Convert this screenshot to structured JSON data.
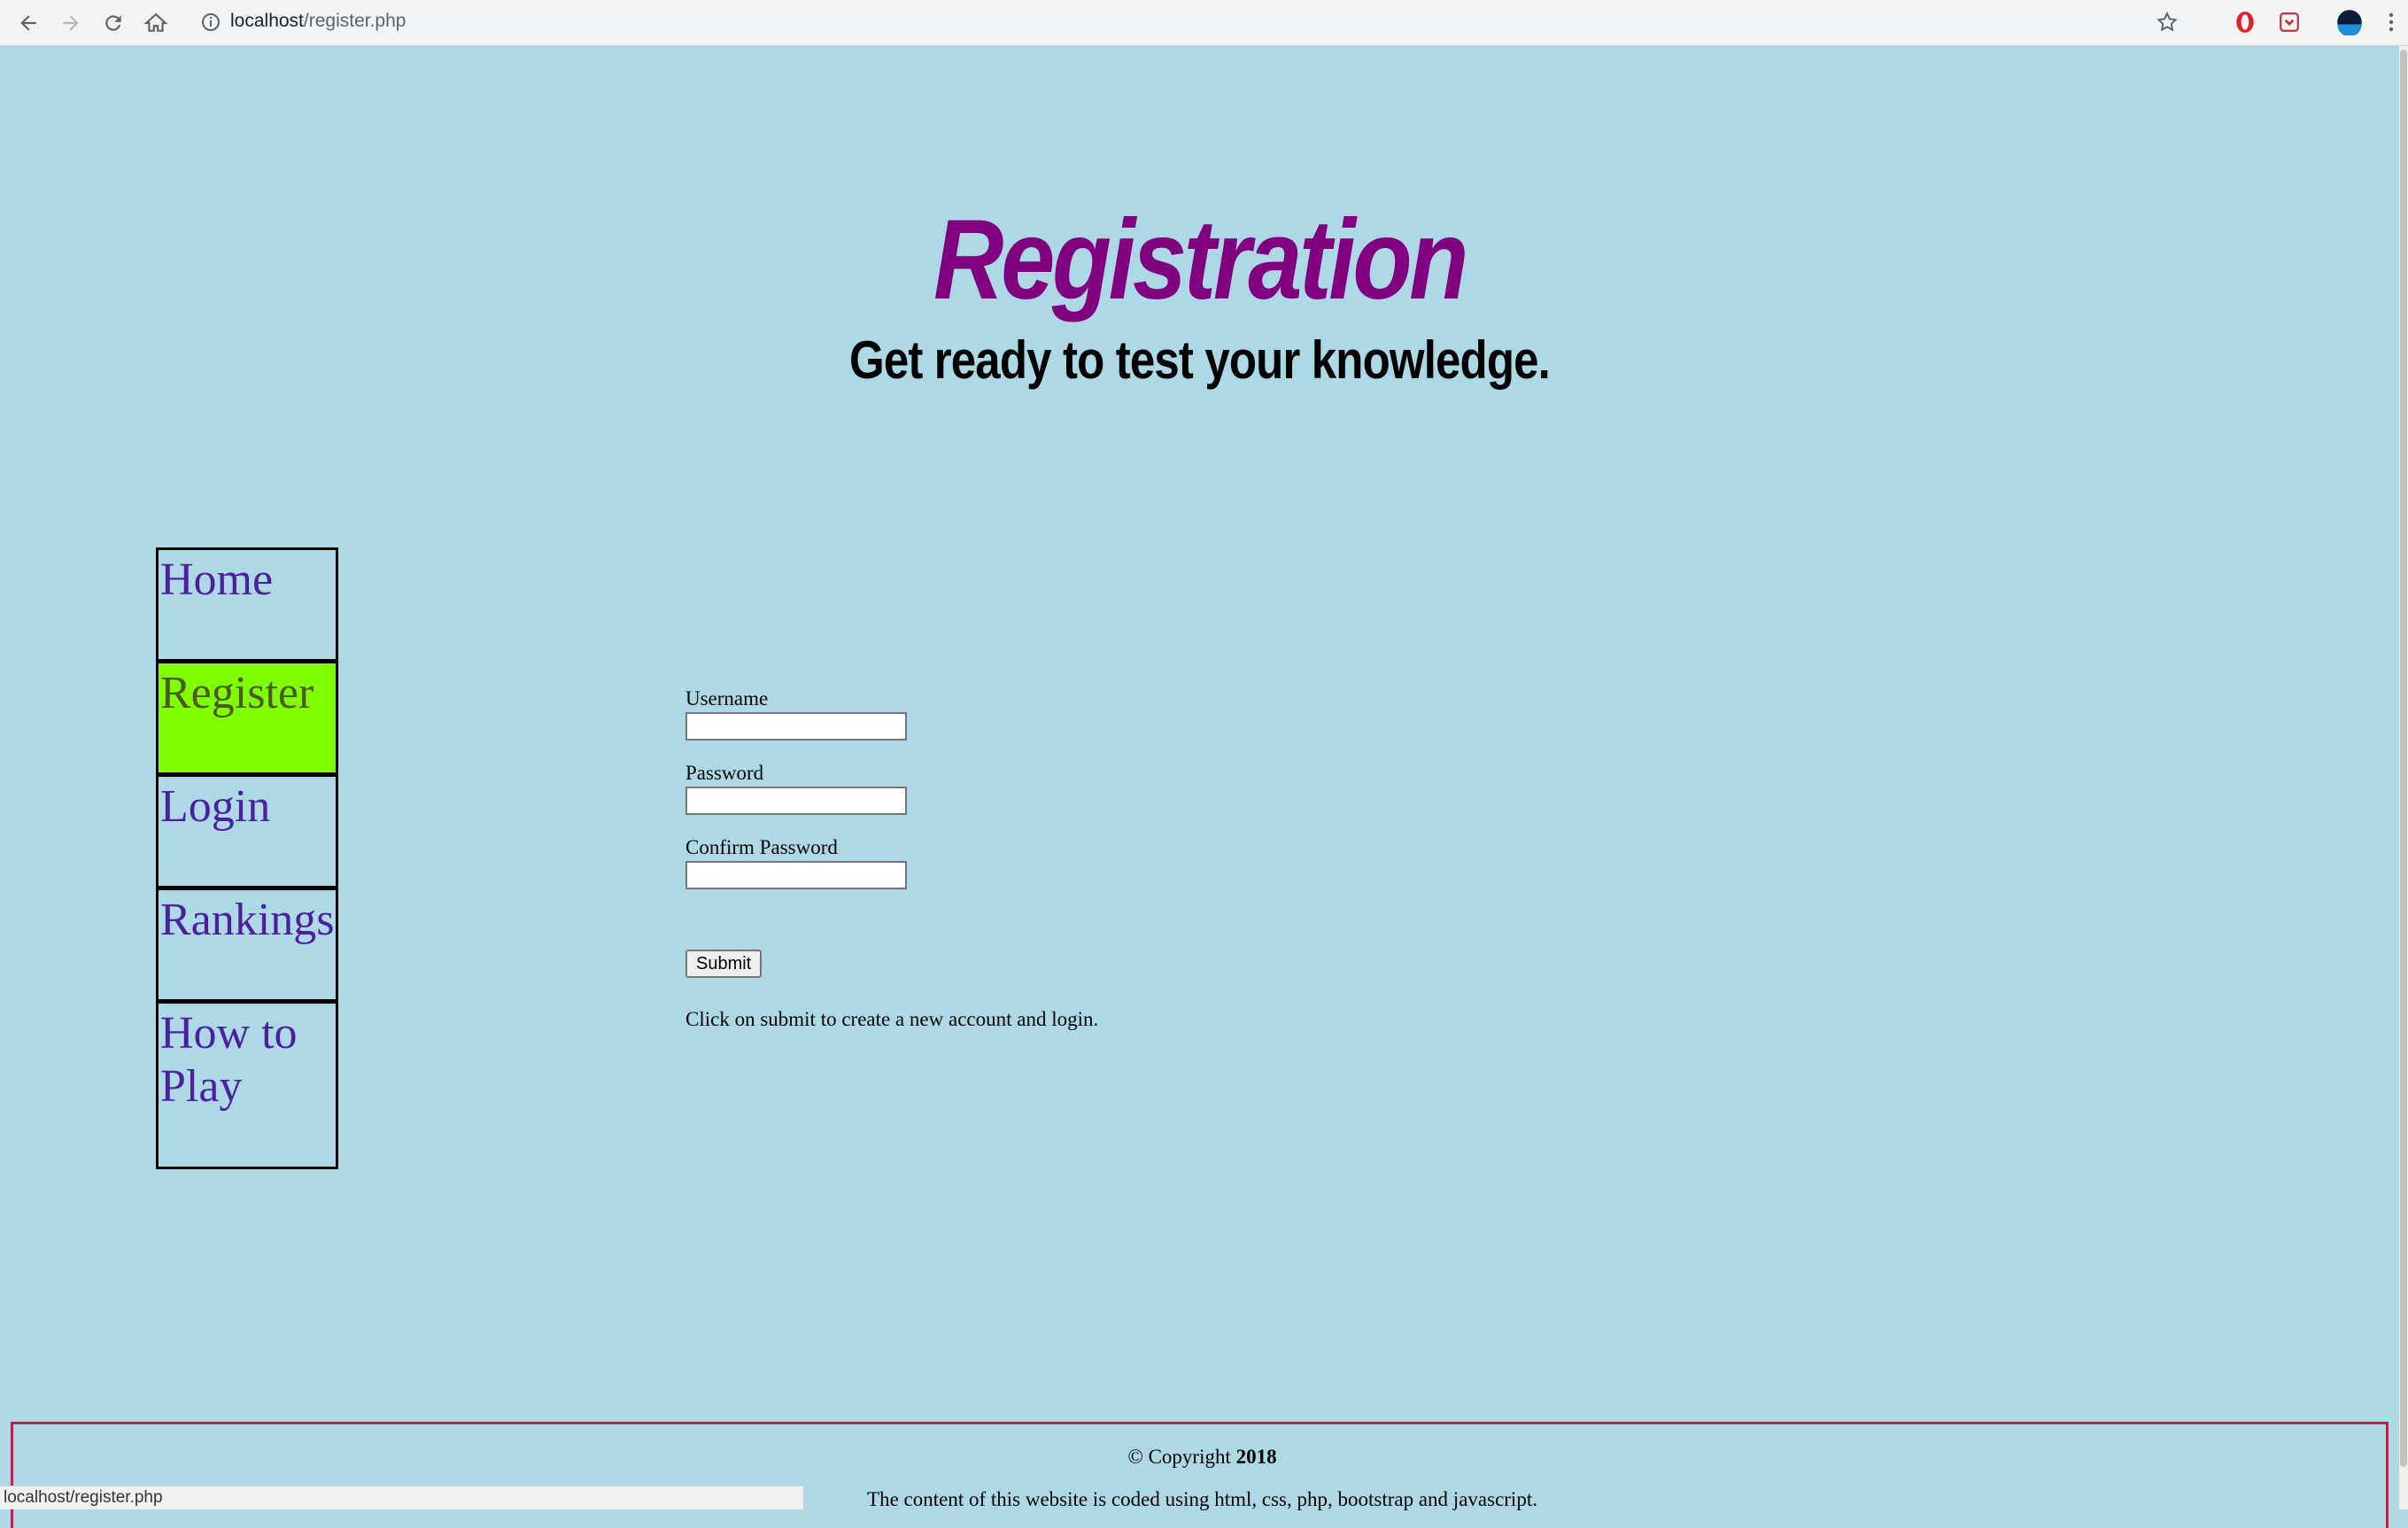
{
  "browser": {
    "url_host": "localhost",
    "url_path": "/register.php",
    "status_url": "localhost/register.php",
    "icons": [
      "back-arrow-icon",
      "forward-arrow-icon",
      "reload-icon",
      "home-icon",
      "info-icon",
      "bookmark-star-icon",
      "opera-icon",
      "pocket-icon",
      "profile-avatar-icon",
      "menu-dots-icon"
    ]
  },
  "header": {
    "title": "Registration",
    "subtitle": "Get ready to test your knowledge."
  },
  "sidebar": {
    "items": [
      {
        "label": "Home",
        "active": false
      },
      {
        "label": "Register",
        "active": true
      },
      {
        "label": "Login",
        "active": false
      },
      {
        "label": "Rankings",
        "active": false
      },
      {
        "label": "How to Play",
        "active": false
      }
    ]
  },
  "form": {
    "username_label": "Username",
    "username_value": "",
    "password_label": "Password",
    "password_value": "",
    "confirm_label": "Confirm Password",
    "confirm_value": "",
    "submit_label": "Submit",
    "hint": "Click on submit to create a new account and login."
  },
  "footer": {
    "copyright_prefix": "© Copyright",
    "copyright_year": "2018",
    "note": "The content of this website is coded using html, css, php, bootstrap and javascript."
  },
  "colors": {
    "page_bg": "#add8e6",
    "title": "#800080",
    "nav_text": "#4b1f9e",
    "nav_active_bg": "#7fff00",
    "footer_border": "#dc143c"
  }
}
